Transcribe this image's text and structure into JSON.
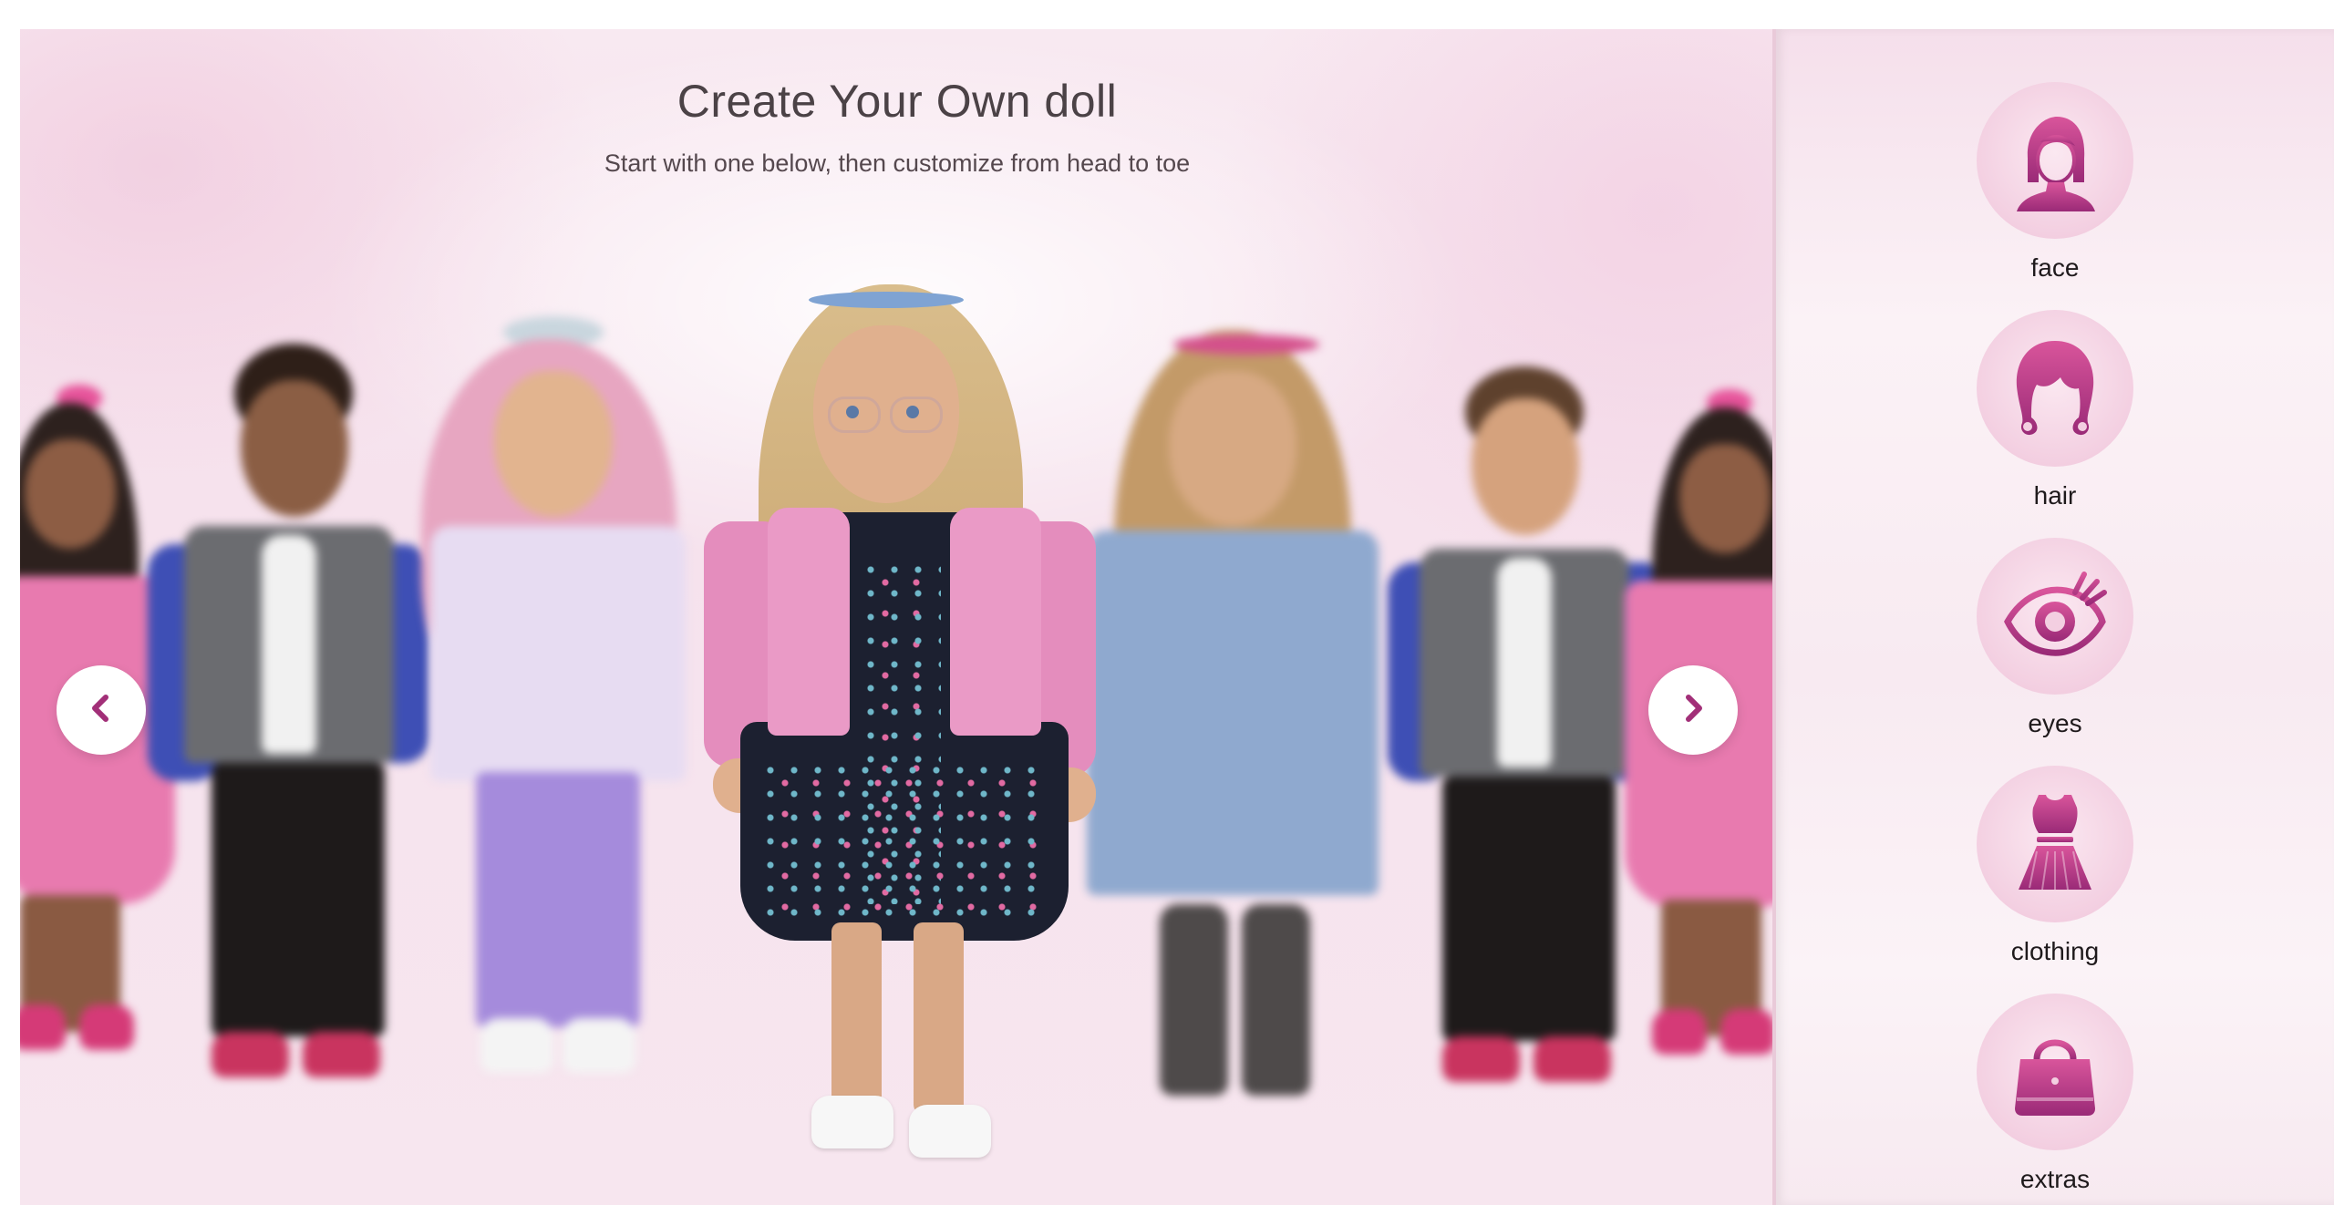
{
  "header": {
    "title": "Create Your Own doll",
    "subtitle": "Start with one below, then customize from head to toe"
  },
  "carousel": {
    "prev_icon": "chevron-left-icon",
    "next_icon": "chevron-right-icon"
  },
  "sidebar": {
    "items": [
      {
        "label": "face",
        "icon": "face-icon"
      },
      {
        "label": "hair",
        "icon": "hair-icon"
      },
      {
        "label": "eyes",
        "icon": "eye-icon"
      },
      {
        "label": "clothing",
        "icon": "dress-icon"
      },
      {
        "label": "extras",
        "icon": "handbag-icon"
      }
    ]
  },
  "colors": {
    "accent": "#b0337f",
    "accent_light": "#d9559b",
    "stage_bg": "#f6e2ed",
    "panel_bg": "#f9eef4"
  }
}
